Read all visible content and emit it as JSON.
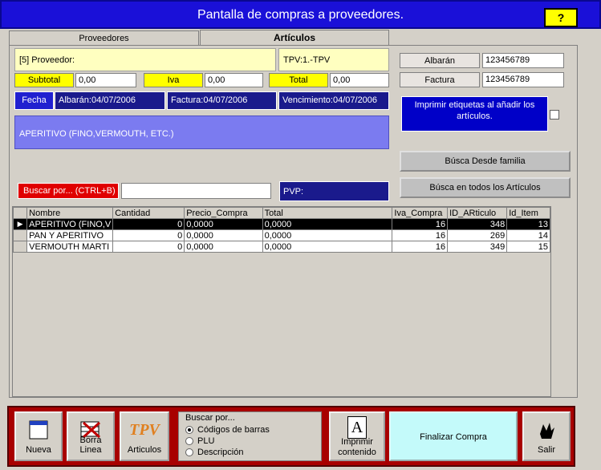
{
  "window": {
    "title": "Pantalla de compras a proveedores.",
    "help_label": "?"
  },
  "tabs": [
    {
      "label": "Proveedores"
    },
    {
      "label": "Artículos"
    }
  ],
  "proveedor": {
    "label": "[5] Proveedor:",
    "tpv": "TPV:1.-TPV"
  },
  "totals": {
    "subtotal_label": "Subtotal",
    "subtotal_value": "0,00",
    "iva_label": "Iva",
    "iva_value": "0,00",
    "total_label": "Total",
    "total_value": "0,00"
  },
  "dates": {
    "fecha_label": "Fecha",
    "albaran": "Albarán:04/07/2006",
    "factura": "Factura:04/07/2006",
    "vencimiento": "Vencimiento:04/07/2006"
  },
  "right_panel": {
    "albaran_label": "Albarán",
    "albaran_value": "123456789",
    "factura_label": "Factura",
    "factura_value": "123456789",
    "etiquetas_text": "Imprimir etiquetas al añadir los artículos.",
    "busca_familia": "Búsca Desde familia",
    "busca_todos": "Búsca en todos los Artículos"
  },
  "family_display": "APERITIVO (FINO,VERMOUTH, ETC.)",
  "search": {
    "label": "Buscar por... (CTRL+B)",
    "value": "",
    "pvp_label": "PVP:"
  },
  "table": {
    "columns": [
      "Nombre",
      "Cantidad",
      "Precio_Compra",
      "Total",
      "Iva_Compra",
      "ID_ARticulo",
      "Id_Item"
    ],
    "rows": [
      [
        "APERITIVO (FINO,V",
        "0",
        "0,0000",
        "0,0000",
        "16",
        "348",
        "13"
      ],
      [
        "PAN Y APERITIVO",
        "0",
        "0,0000",
        "0,0000",
        "16",
        "269",
        "14"
      ],
      [
        "VERMOUTH MARTI",
        "0",
        "0,0000",
        "0,0000",
        "16",
        "349",
        "15"
      ]
    ]
  },
  "toolbar": {
    "nueva": "Nueva",
    "borra_linea": "Borra Linea",
    "articulos": "Articulos",
    "articulos_icon_text": "TPV",
    "buscar_por_title": "Buscar por...",
    "radio_options": [
      "Códigos de barras",
      "PLU",
      "Descripción"
    ],
    "imprimir_line1": "Imprimir",
    "imprimir_line2": "contenido",
    "imprimir_icon_text": "A",
    "finalizar": "Finalizar Compra",
    "salir": "Salir"
  },
  "colors": {
    "title_bar": "#1a10d8",
    "bottom_bar": "#a80000",
    "accent_yellow": "#ffff00"
  }
}
